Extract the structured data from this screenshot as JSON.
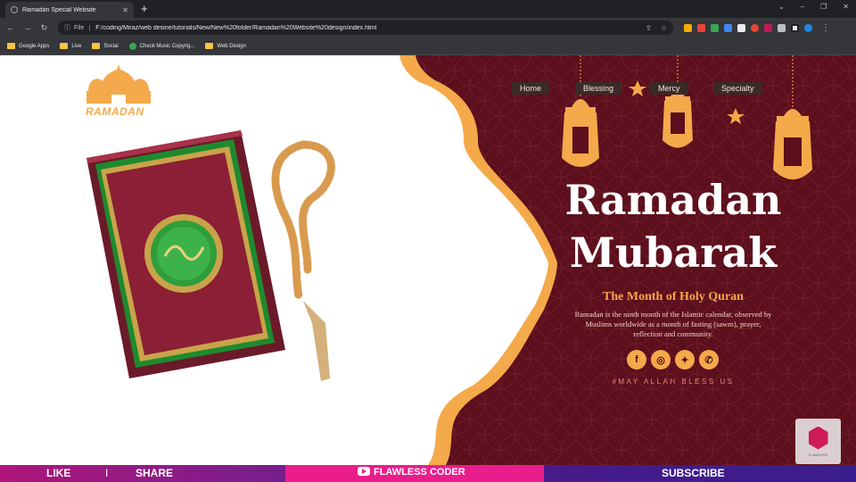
{
  "browser": {
    "tab_title": "Ramadan Special Website",
    "close_glyph": "✕",
    "new_tab_glyph": "+",
    "window_controls": [
      "⌄",
      "–",
      "❐",
      "✕"
    ],
    "nav": {
      "back": "←",
      "forward": "→",
      "reload": "↻"
    },
    "address": {
      "scheme_label": "File",
      "url": "F:/coding/Miraz/web desine/tutorials/New/New%20folder/Ramadan%20Website%20design/index.html"
    },
    "bookmarks": [
      {
        "label": "Google Apps",
        "icon": "apps-icon"
      },
      {
        "label": "Live",
        "icon": "folder-icon"
      },
      {
        "label": "Social",
        "icon": "folder-icon"
      },
      {
        "label": "Check Music Copyrig...",
        "icon": "check-icon"
      },
      {
        "label": "Web Design",
        "icon": "folder-icon"
      }
    ]
  },
  "site": {
    "logo_text": "RAMADAN",
    "nav": [
      "Home",
      "Blessing",
      "Mercy",
      "Specialty"
    ],
    "headline_line1": "Ramadan",
    "headline_line2": "Mubarak",
    "subheading": "The Month of Holy Quran",
    "description": "Ramadan is the ninth month of the Islamic calendar, observed by Muslims worldwide as a month of fasting (sawm), prayer, reflection and community.",
    "social": [
      {
        "glyph": "f",
        "icon": "facebook-icon"
      },
      {
        "glyph": "◎",
        "icon": "instagram-icon"
      },
      {
        "glyph": "✦",
        "icon": "twitter-icon"
      },
      {
        "glyph": "✆",
        "icon": "whatsapp-icon"
      }
    ],
    "tagline": "#MAY ALLAH BLESS US",
    "watermark_text": "FLAWLESS",
    "colors": {
      "maroon": "#5c0f1c",
      "accent": "#f4a94a",
      "white": "#ffffff"
    }
  },
  "banner": {
    "like": "LIKE",
    "divider": "I",
    "share": "SHARE",
    "channel": "FLAWLESS CODER",
    "subscribe": "SUBSCRIBE"
  }
}
